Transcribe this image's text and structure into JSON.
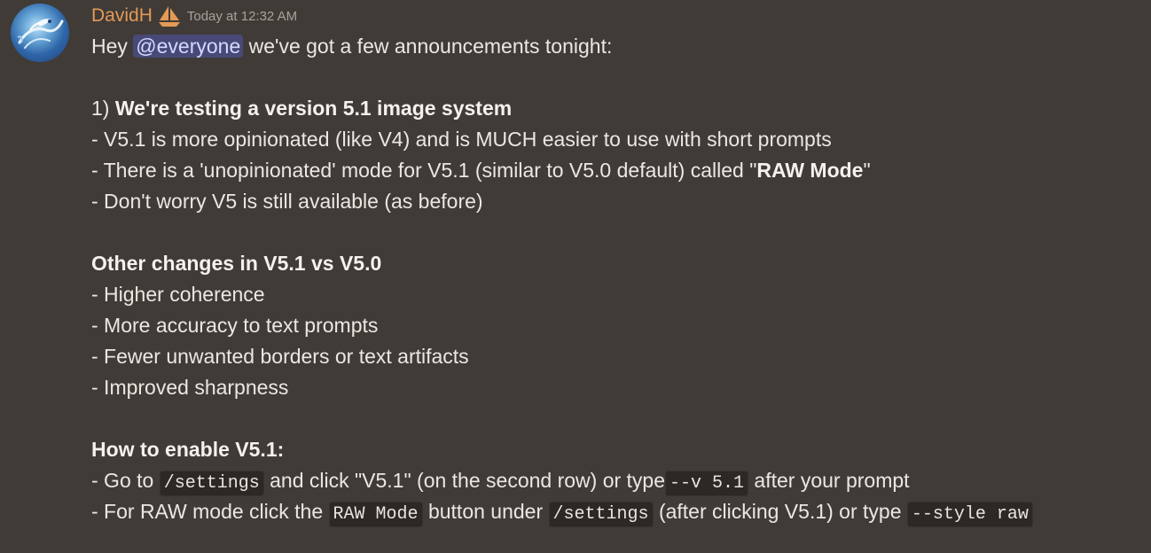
{
  "author": {
    "name": "DavidH",
    "badge_icon": "sailboat-icon",
    "avatar_icon": "dragon-avatar-icon",
    "name_color": "#e39a55"
  },
  "timestamp": "Today at 12:32 AM",
  "message": {
    "intro_before": "Hey",
    "mention": "@everyone",
    "intro_after": "we've got a few announcements tonight:",
    "section1_prefix": "1)",
    "section1_title": "We're testing a version 5.1 image system",
    "section1_items": [
      "- V5.1 is more opinionated (like V4) and is MUCH easier to use with short prompts",
      "- There is a 'unopinionated' mode for V5.1 (similar to V5.0 default) called \"",
      "- Don't worry V5 is still available (as before)"
    ],
    "raw_mode_bold": "RAW Mode",
    "raw_mode_close": "\"",
    "section2_title": "Other changes in V5.1 vs V5.0",
    "section2_items": [
      "- Higher coherence",
      "- More accuracy to text prompts",
      "- Fewer unwanted borders or text artifacts",
      "- Improved sharpness"
    ],
    "section3_title": "How to enable V5.1:",
    "enable_line1": {
      "t1": "- Go to",
      "code1": "/settings",
      "t2": "and click \"V5.1\" (on the second row) or type",
      "code2": "--v 5.1",
      "t3": "after your prompt"
    },
    "enable_line2": {
      "t1": "- For RAW mode click the",
      "code1": "RAW Mode",
      "t2": "button under",
      "code2": "/settings",
      "t3": "(after clicking V5.1) or type",
      "code3": "--style raw"
    }
  },
  "colors": {
    "background": "#403b37",
    "text": "#ebe7e2",
    "timestamp": "#a8a29c",
    "mention_bg": "#5865f2",
    "code_bg": "#2b2826"
  }
}
